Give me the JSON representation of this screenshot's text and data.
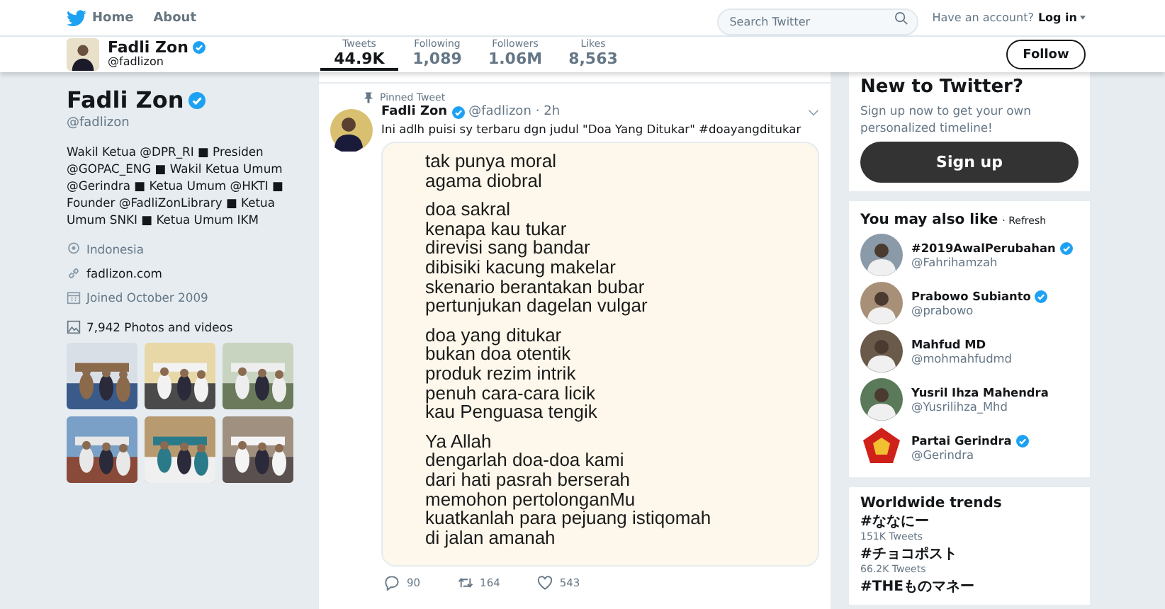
{
  "nav": {
    "links": [
      {
        "label": "Home"
      },
      {
        "label": "About"
      }
    ],
    "search": {
      "placeholder": "Search Twitter"
    },
    "account_prompt": "Have an account?",
    "login": "Log in"
  },
  "profile_bar": {
    "name": "Fadli Zon",
    "verified": true,
    "handle": "@fadlizon",
    "stats": [
      {
        "label": "Tweets",
        "value": "44.9K",
        "selected": true
      },
      {
        "label": "Following",
        "value": "1,089",
        "selected": false
      },
      {
        "label": "Followers",
        "value": "1.06M",
        "selected": false
      },
      {
        "label": "Likes",
        "value": "8,563",
        "selected": false
      }
    ],
    "follow": "Follow"
  },
  "profile": {
    "name": "Fadli Zon",
    "verified": true,
    "handle": "@fadlizon",
    "bio": "Wakil Ketua @DPR_RI ■ Presiden @GOPAC_ENG ■ Wakil Ketua Umum @Gerindra ■ Ketua Umum @HKTI ■ Founder @FadliZonLibrary ■ Ketua Umum SNKI ■ Ketua Umum IKM",
    "location": "Indonesia",
    "website": "fadlizon.com",
    "joined": "Joined October 2009",
    "photos_label": "7,942 Photos and videos"
  },
  "tweet": {
    "pinned_label": "Pinned Tweet",
    "author": "Fadli Zon",
    "verified": true,
    "handle": "@fadlizon",
    "time": "· 2h",
    "text": "Ini adlh puisi sy terbaru dgn judul \"Doa Yang Ditukar\" #doayangditukar",
    "poem": [
      [
        "tak punya moral",
        "agama diobral"
      ],
      [
        "doa sakral",
        "kenapa kau tukar",
        "direvisi sang bandar",
        "dibisiki kacung makelar",
        "skenario berantakan bubar",
        "pertunjukan dagelan vulgar"
      ],
      [
        "doa yang ditukar",
        "bukan doa otentik",
        "produk rezim intrik",
        "penuh cara-cara licik",
        "kau Penguasa tengik"
      ],
      [
        "Ya Allah",
        "dengarlah doa-doa kami",
        "dari hati pasrah berserah",
        "memohon pertolonganMu",
        "kuatkanlah para pejuang istiqomah",
        "di jalan amanah"
      ]
    ],
    "actions": [
      {
        "kind": "reply",
        "count": "90"
      },
      {
        "kind": "retweet",
        "count": "164"
      },
      {
        "kind": "like",
        "count": "543"
      }
    ]
  },
  "signup_card": {
    "title": "New to Twitter?",
    "text": "Sign up now to get your own personalized timeline!",
    "button": "Sign up"
  },
  "suggestions": {
    "title": "You may also like",
    "refresh": "· Refresh",
    "accounts": [
      {
        "name": "#2019AwalPerubahan",
        "handle": "@Fahrihamzah",
        "verified": true
      },
      {
        "name": "Prabowo Subianto",
        "handle": "@prabowo",
        "verified": true
      },
      {
        "name": "Mahfud MD",
        "handle": "@mohmahfudmd",
        "verified": false
      },
      {
        "name": "Yusril Ihza Mahendra",
        "handle": "@Yusrilihza_Mhd",
        "verified": false
      },
      {
        "name": "Partai Gerindra",
        "handle": "@Gerindra",
        "verified": true,
        "kind": "emblem"
      }
    ]
  },
  "trends": {
    "title": "Worldwide trends",
    "items": [
      {
        "tag": "#ななにー",
        "count": "151K Tweets"
      },
      {
        "tag": "#チョコポスト",
        "count": "66.2K Tweets"
      },
      {
        "tag": "#THEものマネー"
      }
    ]
  }
}
